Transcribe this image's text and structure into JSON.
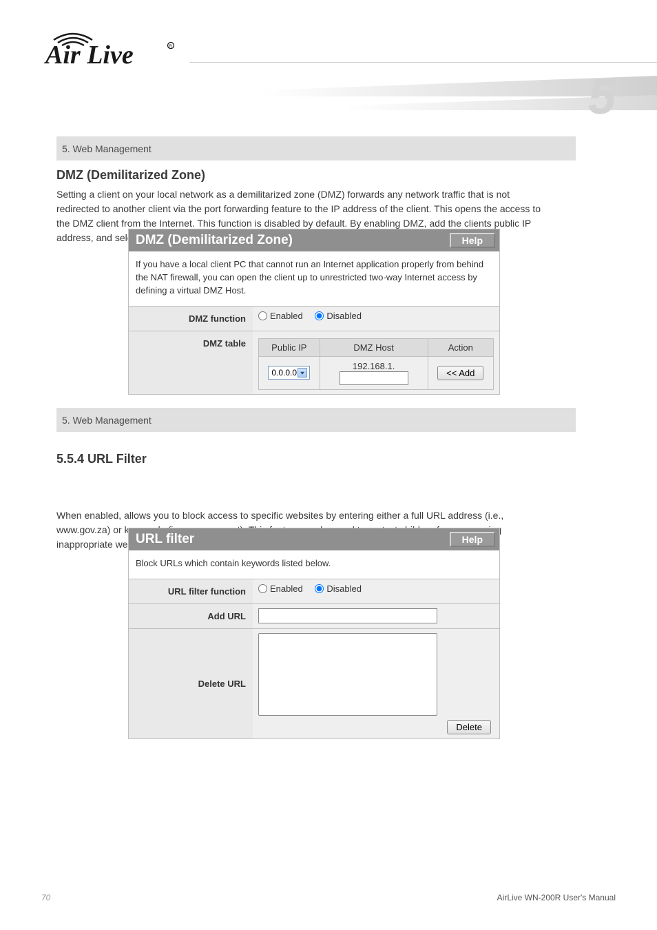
{
  "brand": "AirLive",
  "chapter_number": "5",
  "bar1_text": "5. Web Management",
  "section1": {
    "title": "DMZ (Demilitarized Zone)",
    "preface": "Setting a client on your local network as a demilitarized zone (DMZ) forwards any network traffic that is not redirected to another client via the port forwarding feature to the IP address of the client. This opens the access to the DMZ client from the Internet. This function is disabled by default. By enabling DMZ, add the clients public IP address, and select a DMZ Host below.",
    "panel_title": "DMZ (Demilitarized Zone)",
    "help": "Help",
    "panel_desc": "If you have a local client PC that cannot run an Internet application properly from behind the NAT firewall, you can open the client up to unrestricted two-way Internet access by defining a virtual DMZ Host.",
    "func_label": "DMZ function",
    "enabled": "Enabled",
    "disabled": "Disabled",
    "table_label": "DMZ table",
    "th_ip": "Public IP",
    "th_host": "DMZ Host",
    "th_action": "Action",
    "ip_option": "0.0.0.0",
    "host_prefix": "192.168.1.",
    "host_value": "",
    "add_btn": "<< Add"
  },
  "bar2_text": "5. Web Management",
  "section2": {
    "title": "5.5.4 URL Filter",
    "panel_title": "URL filter",
    "help": "Help",
    "panel_desc": "Block URLs which contain keywords listed below.",
    "func_label": "URL filter function",
    "enabled": "Enabled",
    "disabled": "Disabled",
    "add_label": "Add URL",
    "add_value": "",
    "delete_label": "Delete URL",
    "delete_btn": "Delete"
  },
  "footer": {
    "page": "70",
    "product": "AirLive WN-200R User's Manual"
  }
}
